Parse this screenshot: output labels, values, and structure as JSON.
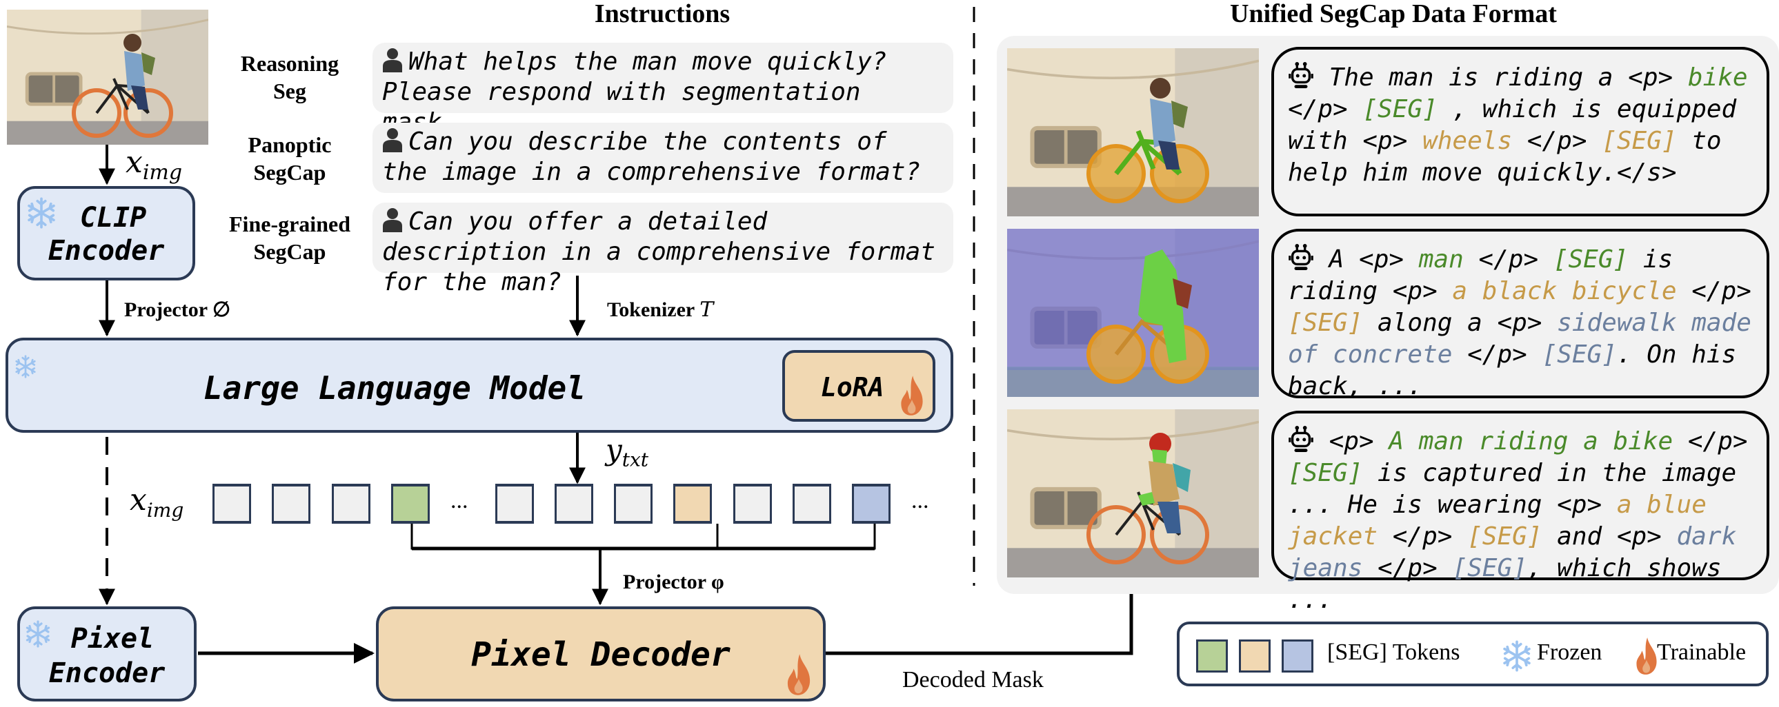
{
  "sections": {
    "instructions_title": "Instructions",
    "data_format_title": "Unified SegCap Data Format"
  },
  "inputs": {
    "image_alt": "man riding a bicycle in front of a building",
    "x_img_label": "x",
    "x_img_sub": "img"
  },
  "modules": {
    "clip_encoder": {
      "line1": "CLIP",
      "line2": "Encoder",
      "state": "frozen"
    },
    "llm": {
      "label": "Large Language Model",
      "state": "frozen"
    },
    "lora": {
      "label": "LoRA",
      "state": "trainable"
    },
    "pixel_encoder": {
      "line1": "Pixel",
      "line2": "Encoder",
      "state": "frozen"
    },
    "pixel_decoder": {
      "label": "Pixel Decoder",
      "state": "trainable"
    }
  },
  "edges": {
    "projector_phi_empty": "Projector ∅",
    "tokenizer": "Tokenizer",
    "tokenizer_symbol": "T",
    "y_txt": "y",
    "y_txt_sub": "txt",
    "projector_varphi": "Projector φ",
    "decoded_mask": "Decoded Mask"
  },
  "tasks": [
    {
      "label_line1": "Reasoning",
      "label_line2": "Seg",
      "instruction": "What helps the man move quickly? Please respond with segmentation mask."
    },
    {
      "label_line1": "Panoptic",
      "label_line2": "SegCap",
      "instruction": "Can you describe the contents of the image in a comprehensive format?"
    },
    {
      "label_line1": "Fine-grained",
      "label_line2": "SegCap",
      "instruction": "Can you offer a detailed description in a comprehensive format for the man?"
    }
  ],
  "token_sequence": {
    "label": "x",
    "label_sub": "img",
    "ellipsis": "...",
    "tokens": [
      "plain",
      "plain",
      "plain",
      "seg-green",
      "ellipsis",
      "plain",
      "plain",
      "plain",
      "seg-orange",
      "plain",
      "plain",
      "seg-blue",
      "ellipsis"
    ]
  },
  "captions": [
    {
      "mask_style": "bike-green-wheels-orange",
      "segments": [
        {
          "t": " The man is riding a <p> ",
          "c": ""
        },
        {
          "t": "bike",
          "c": "g"
        },
        {
          "t": " </p> ",
          "c": ""
        },
        {
          "t": "[SEG]",
          "c": "g"
        },
        {
          "t": " , which is equipped with <p> ",
          "c": ""
        },
        {
          "t": "wheels",
          "c": "o"
        },
        {
          "t": " </p> ",
          "c": ""
        },
        {
          "t": "[SEG]",
          "c": "o"
        },
        {
          "t": " to help him move quickly.</s>",
          "c": ""
        }
      ]
    },
    {
      "mask_style": "panoptic-man-bicycle-sidewalk",
      "segments": [
        {
          "t": " A <p> ",
          "c": ""
        },
        {
          "t": "man",
          "c": "g"
        },
        {
          "t": " </p> ",
          "c": ""
        },
        {
          "t": "[SEG]",
          "c": "g"
        },
        {
          "t": " is riding <p> ",
          "c": ""
        },
        {
          "t": "a black bicycle",
          "c": "o"
        },
        {
          "t": " </p> ",
          "c": ""
        },
        {
          "t": "[SEG]",
          "c": "o"
        },
        {
          "t": " along a <p> ",
          "c": ""
        },
        {
          "t": "sidewalk made of concrete",
          "c": "b"
        },
        {
          "t": " </p> ",
          "c": ""
        },
        {
          "t": "[SEG]",
          "c": "b"
        },
        {
          "t": ". On his back, ...",
          "c": ""
        }
      ]
    },
    {
      "mask_style": "fine-grained-man-jacket-jeans",
      "segments": [
        {
          "t": " <p> ",
          "c": ""
        },
        {
          "t": "A man riding a bike",
          "c": "g"
        },
        {
          "t": " </p> ",
          "c": ""
        },
        {
          "t": "[SEG]",
          "c": "g"
        },
        {
          "t": " is captured in the image ... He is wearing <p> ",
          "c": ""
        },
        {
          "t": "a blue jacket",
          "c": "o"
        },
        {
          "t": " </p> ",
          "c": ""
        },
        {
          "t": "[SEG]",
          "c": "o"
        },
        {
          "t": " and <p> ",
          "c": ""
        },
        {
          "t": "dark jeans",
          "c": "b"
        },
        {
          "t": " </p> ",
          "c": ""
        },
        {
          "t": "[SEG]",
          "c": "b"
        },
        {
          "t": ", which shows ...",
          "c": ""
        }
      ]
    }
  ],
  "legend": {
    "seg_tokens": "[SEG] Tokens",
    "frozen": "Frozen",
    "trainable": "Trainable"
  },
  "colors": {
    "seg_green": "#b7d197",
    "seg_orange": "#f1d8b2",
    "seg_blue": "#b6c4e2",
    "module_blue": "#e1e9f6",
    "module_tan": "#f1d8b2",
    "border": "#2b3a55",
    "text_green": "#4a8a2a",
    "text_orange": "#c69a48",
    "text_blue": "#6b7f9e",
    "frozen_icon": "#9cc3f0",
    "trainable_icon": "#e0763f",
    "panel_bg": "#f2f2f2"
  }
}
